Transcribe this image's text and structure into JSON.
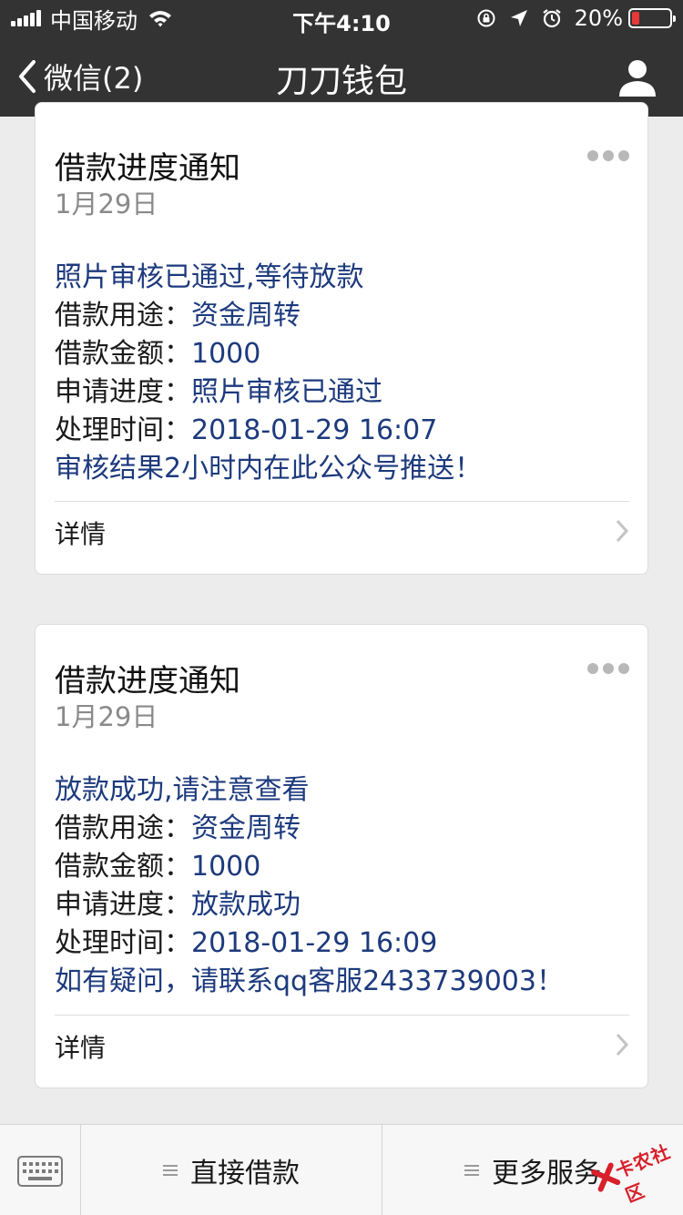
{
  "status_bar": {
    "carrier": "中国移动",
    "time": "下午4:10",
    "battery_percent": "20%",
    "battery_level": 0.2,
    "icons": [
      "signal-icon",
      "wifi-icon",
      "rotation-lock-icon",
      "location-icon",
      "alarm-icon",
      "battery-icon"
    ]
  },
  "nav": {
    "back_label": "微信(2)",
    "title": "刀刀钱包",
    "profile_icon": "person-icon"
  },
  "cards": [
    {
      "title": "借款进度通知",
      "date": "1月29日",
      "lines": [
        "照片审核已通过,等待放款",
        "借款用途：资金周转",
        "借款金额：1000",
        "申请进度：照片审核已通过",
        "处理时间：2018-01-29 16:07",
        "审核结果2小时内在此公众号推送！"
      ],
      "items": [
        {
          "label": "借款用途：",
          "value": "资金周转"
        },
        {
          "label": "借款金额：",
          "value": "1000"
        },
        {
          "label": "申请进度：",
          "value": "照片审核已通过"
        },
        {
          "label": "处理时间：",
          "value": "2018-01-29 16:07"
        }
      ],
      "headline": "照片审核已通过,等待放款",
      "footer": "审核结果2小时内在此公众号推送！",
      "detail_label": "详情"
    },
    {
      "title": "借款进度通知",
      "date": "1月29日",
      "headline": "放款成功,请注意查看",
      "items": [
        {
          "label": "借款用途：",
          "value": "资金周转"
        },
        {
          "label": "借款金额：",
          "value": "1000"
        },
        {
          "label": "申请进度：",
          "value": "放款成功"
        },
        {
          "label": "处理时间：",
          "value": "2018-01-29 16:09"
        }
      ],
      "footer": "如有疑问，请联系qq客服2433739003！",
      "detail_label": "详情"
    }
  ],
  "bottom_menu": {
    "keyboard_icon": "keyboard-icon",
    "items": [
      {
        "label": "直接借款"
      },
      {
        "label": "更多服务"
      }
    ]
  },
  "watermark": {
    "text": "卡农社区"
  },
  "colors": {
    "bar_background": "#333333",
    "page_background": "#ececec",
    "template_value_blue": "#1d3a7d",
    "battery_low": "#e53a3a",
    "watermark_red": "#d8202a"
  }
}
